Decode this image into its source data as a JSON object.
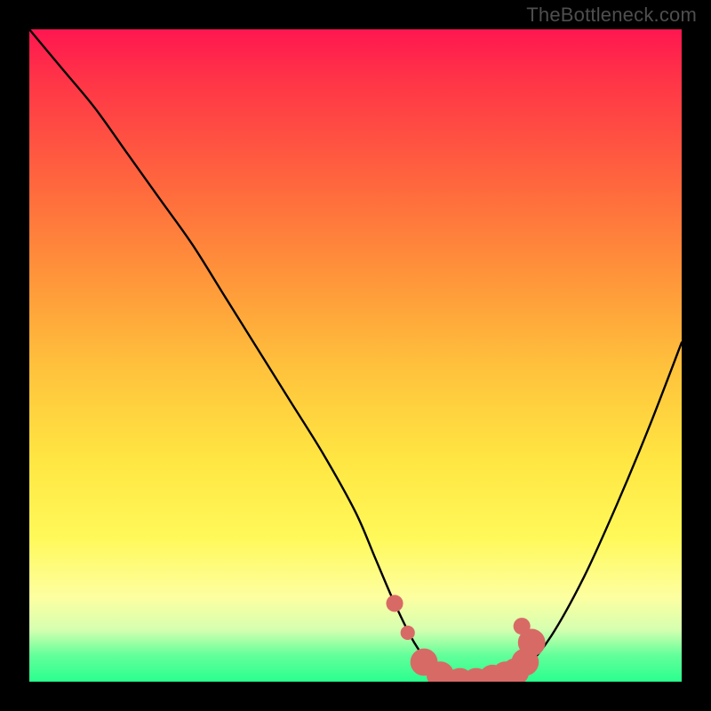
{
  "attribution": "TheBottleneck.com",
  "colors": {
    "page_bg": "#000000",
    "curve_stroke": "#000000",
    "marker_fill": "#d86a66",
    "marker_stroke": "#d86a66",
    "attribution_text": "#4e4e4e",
    "gradient_stops": [
      "#ff1650",
      "#ff3547",
      "#ff6b3d",
      "#ff953a",
      "#ffc23c",
      "#ffe642",
      "#fff95a",
      "#fdffa0",
      "#d6ffb0",
      "#62ff9a",
      "#2aff8e"
    ]
  },
  "chart_data": {
    "type": "line",
    "title": "",
    "xlabel": "",
    "ylabel": "",
    "xlim": [
      0,
      100
    ],
    "ylim": [
      0,
      100
    ],
    "grid": false,
    "legend": false,
    "series": [
      {
        "name": "bottleneck-curve",
        "x": [
          0,
          5,
          10,
          15,
          20,
          25,
          30,
          35,
          40,
          45,
          50,
          53,
          56,
          59,
          62,
          65,
          67,
          70,
          73,
          76,
          80,
          85,
          90,
          95,
          100
        ],
        "y": [
          100,
          94,
          88,
          81,
          74,
          67,
          59,
          51,
          43,
          35,
          26,
          19,
          12,
          6,
          2,
          0,
          0,
          0,
          0,
          2,
          7,
          16,
          27,
          39,
          52
        ]
      }
    ],
    "markers": [
      {
        "x": 56.0,
        "y": 12.0,
        "r": 1.3
      },
      {
        "x": 58.0,
        "y": 7.5,
        "r": 1.1
      },
      {
        "x": 60.5,
        "y": 3.0,
        "r": 2.1
      },
      {
        "x": 63.0,
        "y": 1.0,
        "r": 2.1
      },
      {
        "x": 66.0,
        "y": 0.0,
        "r": 2.1
      },
      {
        "x": 68.5,
        "y": 0.0,
        "r": 2.1
      },
      {
        "x": 71.0,
        "y": 0.5,
        "r": 2.1
      },
      {
        "x": 73.0,
        "y": 1.0,
        "r": 2.1
      },
      {
        "x": 74.5,
        "y": 1.5,
        "r": 2.1
      },
      {
        "x": 76.0,
        "y": 3.0,
        "r": 2.1
      },
      {
        "x": 77.0,
        "y": 6.0,
        "r": 2.1
      },
      {
        "x": 75.5,
        "y": 8.5,
        "r": 1.3
      }
    ]
  }
}
